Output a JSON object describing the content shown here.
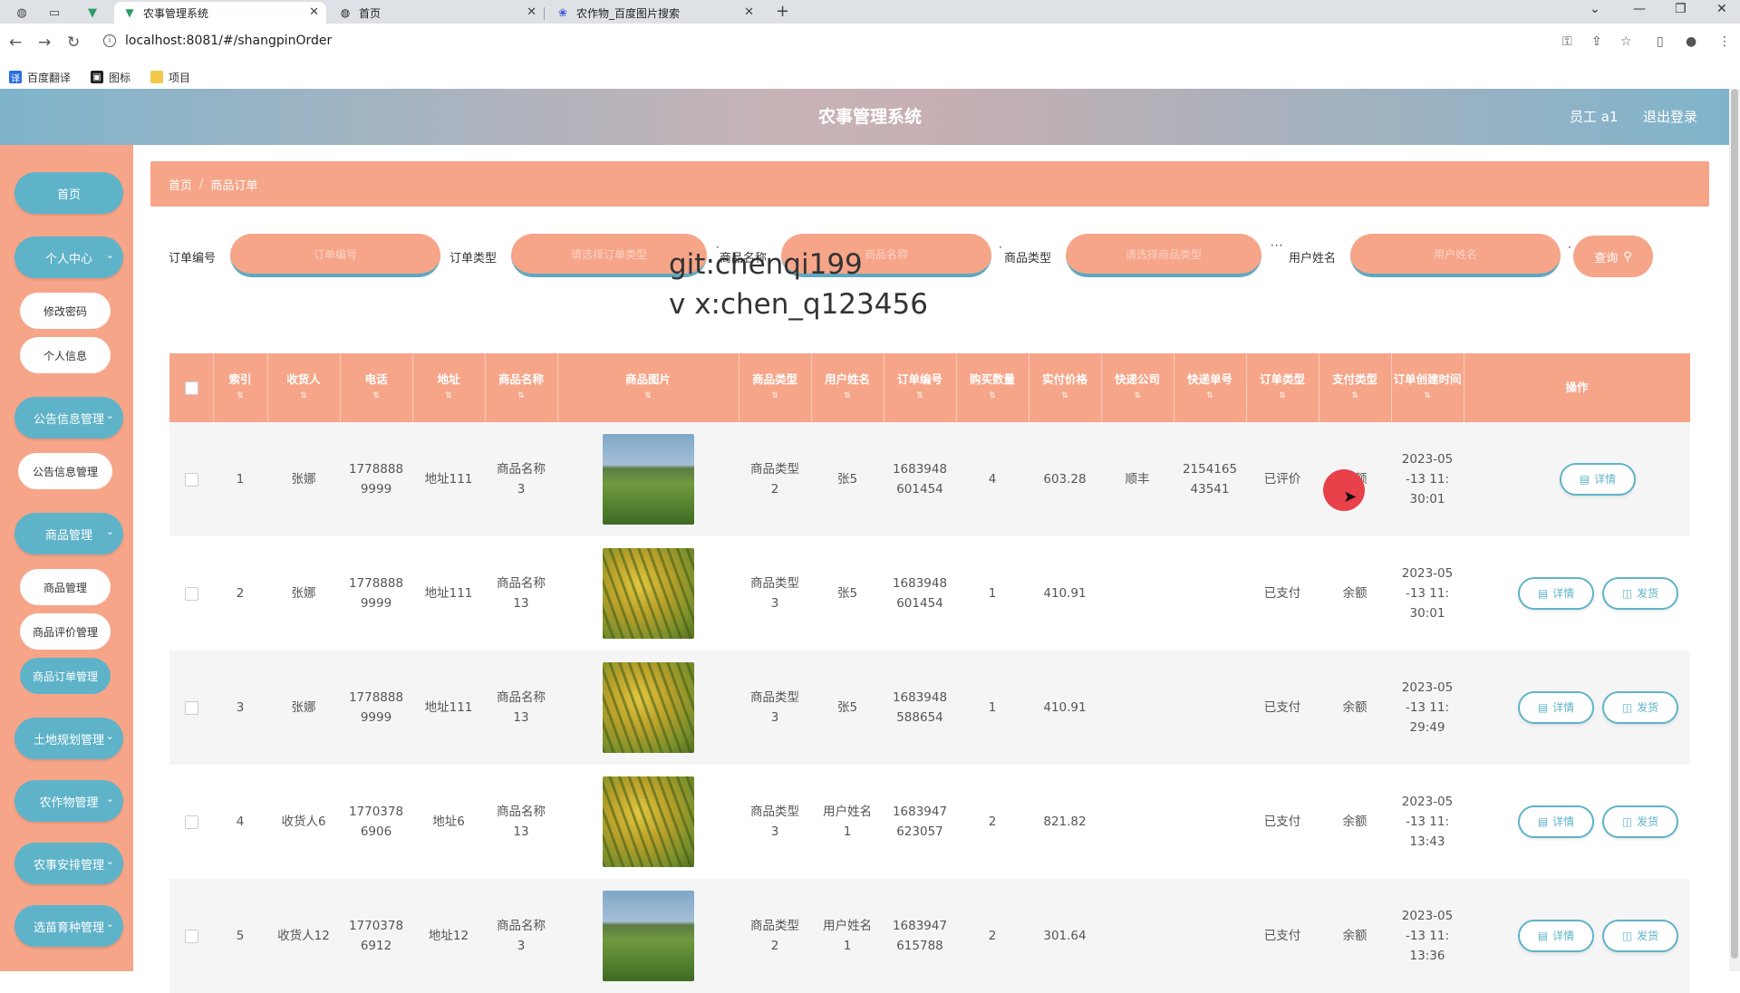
{
  "browser": {
    "tabs": [
      {
        "title": "农事管理系统",
        "active": true
      },
      {
        "title": "首页",
        "active": false
      },
      {
        "title": "农作物_百度图片搜索",
        "active": false
      }
    ],
    "url": "localhost:8081/#/shangpinOrder",
    "bookmarks": [
      "百度翻译",
      "图标",
      "项目"
    ]
  },
  "header": {
    "title": "农事管理系统",
    "user": "员工 a1",
    "logout": "退出登录"
  },
  "sidebar": {
    "home": "首页",
    "personal_center": "个人中心",
    "change_password": "修改密码",
    "personal_info": "个人信息",
    "notice_group": "公告信息管理",
    "notice_manage": "公告信息管理",
    "goods_group": "商品管理",
    "goods_manage": "商品管理",
    "goods_review": "商品评价管理",
    "goods_order": "商品订单管理",
    "land": "土地规划管理",
    "crop": "农作物管理",
    "farm_schedule": "农事安排管理",
    "seedling": "选苗育种管理"
  },
  "breadcrumb": {
    "home": "首页",
    "current": "商品订单"
  },
  "search": {
    "order_no_label": "订单编号",
    "order_no_placeholder": "订单编号",
    "order_type_label": "订单类型",
    "order_type_placeholder": "请选择订单类型",
    "goods_name_label": "商品名称",
    "goods_name_placeholder": "商品名称",
    "goods_type_label": "商品类型",
    "goods_type_placeholder": "请选择商品类型",
    "user_name_label": "用户姓名",
    "user_name_placeholder": "用户姓名",
    "query_button": "查询"
  },
  "watermark": {
    "line1": "git:chenqi199",
    "line2": "v x:chen_q123456"
  },
  "table": {
    "columns": [
      "索引",
      "收货人",
      "电话",
      "地址",
      "商品名称",
      "商品图片",
      "商品类型",
      "用户姓名",
      "订单编号",
      "购买数量",
      "实付价格",
      "快递公司",
      "快递单号",
      "订单类型",
      "支付类型",
      "订单创建时间",
      "操作"
    ],
    "detail_label": "详情",
    "ship_label": "发货",
    "rows": [
      {
        "index": "1",
        "receiver": "张娜",
        "phone": "17788889999",
        "address": "地址111",
        "goods_name": "商品名称3",
        "image": "field",
        "goods_type": "商品类型2",
        "user_name": "张5",
        "order_no": "1683948601454",
        "qty": "4",
        "price": "603.28",
        "express": "顺丰",
        "express_no": "215416543541",
        "order_type": "已评价",
        "pay_type": "余额",
        "created": "2023-05-13 11:30:01",
        "can_ship": false
      },
      {
        "index": "2",
        "receiver": "张娜",
        "phone": "17788889999",
        "address": "地址111",
        "goods_name": "商品名称13",
        "image": "rice",
        "goods_type": "商品类型3",
        "user_name": "张5",
        "order_no": "1683948601454",
        "qty": "1",
        "price": "410.91",
        "express": "",
        "express_no": "",
        "order_type": "已支付",
        "pay_type": "余额",
        "created": "2023-05-13 11:30:01",
        "can_ship": true
      },
      {
        "index": "3",
        "receiver": "张娜",
        "phone": "17788889999",
        "address": "地址111",
        "goods_name": "商品名称13",
        "image": "rice",
        "goods_type": "商品类型3",
        "user_name": "张5",
        "order_no": "1683948588654",
        "qty": "1",
        "price": "410.91",
        "express": "",
        "express_no": "",
        "order_type": "已支付",
        "pay_type": "余额",
        "created": "2023-05-13 11:29:49",
        "can_ship": true
      },
      {
        "index": "4",
        "receiver": "收货人6",
        "phone": "17703786906",
        "address": "地址6",
        "goods_name": "商品名称13",
        "image": "rice",
        "goods_type": "商品类型3",
        "user_name": "用户姓名1",
        "order_no": "1683947623057",
        "qty": "2",
        "price": "821.82",
        "express": "",
        "express_no": "",
        "order_type": "已支付",
        "pay_type": "余额",
        "created": "2023-05-13 11:13:43",
        "can_ship": true
      },
      {
        "index": "5",
        "receiver": "收货人12",
        "phone": "17703786912",
        "address": "地址12",
        "goods_name": "商品名称3",
        "image": "field",
        "goods_type": "商品类型2",
        "user_name": "用户姓名1",
        "order_no": "1683947615788",
        "qty": "2",
        "price": "301.64",
        "express": "",
        "express_no": "",
        "order_type": "已支付",
        "pay_type": "余额",
        "created": "2023-05-13 11:13:36",
        "can_ship": true
      }
    ]
  },
  "colors": {
    "accent_salmon": "#f6a589",
    "accent_teal": "#5fb3c9"
  }
}
